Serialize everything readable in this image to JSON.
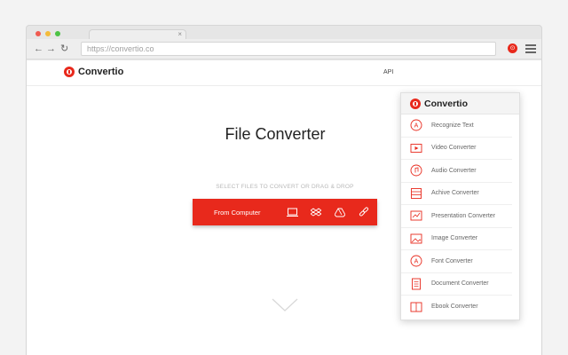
{
  "browser": {
    "tab_close": "×",
    "url": "https://convertio.co",
    "ext_label": "⊙"
  },
  "site": {
    "brand": "Convertio",
    "nav_api": "API",
    "title": "File Converter",
    "subtitle": "SELECT FILES TO CONVERT OR DRAG & DROP",
    "cta_label": "From Computer"
  },
  "dropdown": {
    "brand": "Convertio",
    "items": [
      {
        "label": "Recognize Text",
        "icon": "ocr-icon"
      },
      {
        "label": "Video Converter",
        "icon": "video-icon"
      },
      {
        "label": "Audio Converter",
        "icon": "audio-icon"
      },
      {
        "label": "Achive Converter",
        "icon": "archive-icon"
      },
      {
        "label": "Presentation Converter",
        "icon": "presentation-icon"
      },
      {
        "label": "Image Converter",
        "icon": "image-icon"
      },
      {
        "label": "Font Converter",
        "icon": "font-icon"
      },
      {
        "label": "Document Converter",
        "icon": "document-icon"
      },
      {
        "label": "Ebook Converter",
        "icon": "ebook-icon"
      }
    ]
  },
  "colors": {
    "accent": "#e8291c",
    "text": "#222222",
    "muted": "#666666"
  }
}
